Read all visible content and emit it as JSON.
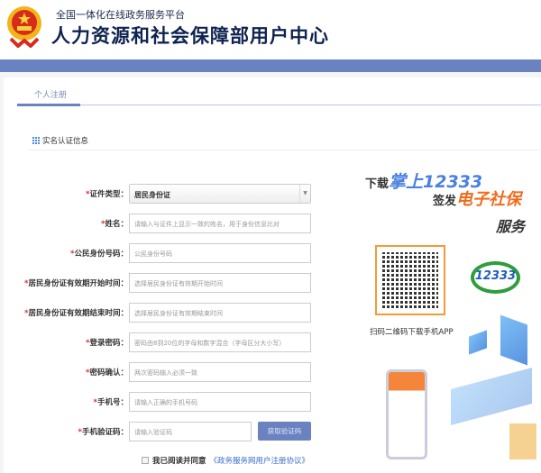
{
  "header": {
    "subtitle": "全国一体化在线政务服务平台",
    "title": "人力资源和社会保障部用户中心"
  },
  "tab": {
    "label": "个人注册"
  },
  "section": {
    "title": "实名认证信息"
  },
  "form": {
    "fields": [
      {
        "label": "证件类型：",
        "type": "select",
        "value": "居民身份证",
        "placeholder": ""
      },
      {
        "label": "姓名：",
        "type": "text",
        "placeholder": "请输入与证件上显示一致的姓名，用于身份信息比对"
      },
      {
        "label": "公民身份号码：",
        "type": "text",
        "placeholder": "公民身份号码"
      },
      {
        "label": "居民身份证有效期开始时间：",
        "type": "text",
        "placeholder": "选择居民身份证有效期开始时间"
      },
      {
        "label": "居民身份证有效期结束时间：",
        "type": "text",
        "placeholder": "选择居民身份证有效期结束时间"
      },
      {
        "label": "登录密码：",
        "type": "password",
        "placeholder": "密码由8到20位的字母和数字混合（字母区分大小写）"
      },
      {
        "label": "密码确认：",
        "type": "password",
        "placeholder": "两次密码输入必须一致"
      },
      {
        "label": "手机号：",
        "type": "text",
        "placeholder": "请输入正确的手机号码"
      },
      {
        "label": "手机验证码：",
        "type": "text",
        "placeholder": "请输入验证码"
      }
    ],
    "required_mark": "*",
    "get_code_button": "获取验证码",
    "agree_text": "我已阅读并同意",
    "agreement_link": "《政务服务网用户注册协议》"
  },
  "promo": {
    "line1_prefix": "下载",
    "line1_highlight": "掌上12333",
    "line2_prefix": "签发",
    "line2_highlight": "电子社保",
    "line3": "服务",
    "qr_caption": "扫码二维码下载手机APP",
    "logo_text": "12333"
  },
  "colors": {
    "accent": "#6a83c0",
    "required": "#e03030",
    "link": "#3a6fc8"
  }
}
